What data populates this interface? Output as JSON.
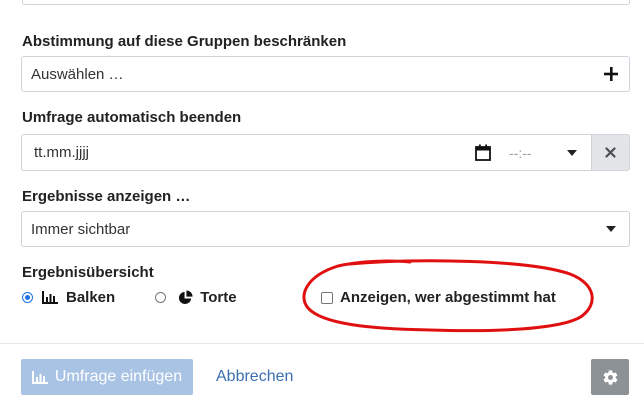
{
  "groups": {
    "label": "Abstimmung auf diese Gruppen beschränken",
    "placeholder": "Auswählen …"
  },
  "auto_end": {
    "label": "Umfrage automatisch beenden",
    "date_placeholder": "tt.mm.jjjj",
    "time_placeholder": "--:--"
  },
  "results_visibility": {
    "label": "Ergebnisse anzeigen …",
    "selected": "Immer sichtbar"
  },
  "results_overview": {
    "label": "Ergebnisübersicht",
    "options": [
      {
        "label": "Balken",
        "icon": "bar-chart-icon",
        "checked": true
      },
      {
        "label": "Torte",
        "icon": "pie-chart-icon",
        "checked": false
      }
    ],
    "show_voters_label": "Anzeigen, wer abgestimmt hat",
    "show_voters_checked": false
  },
  "footer": {
    "insert_label": "Umfrage einfügen",
    "cancel_label": "Abbrechen",
    "settings_icon": "gear-icon"
  },
  "colors": {
    "primary_disabled": "#a8c3e4",
    "link": "#3a6fb0",
    "annotation": "#e01010",
    "radio_checked": "#1a73e8"
  }
}
